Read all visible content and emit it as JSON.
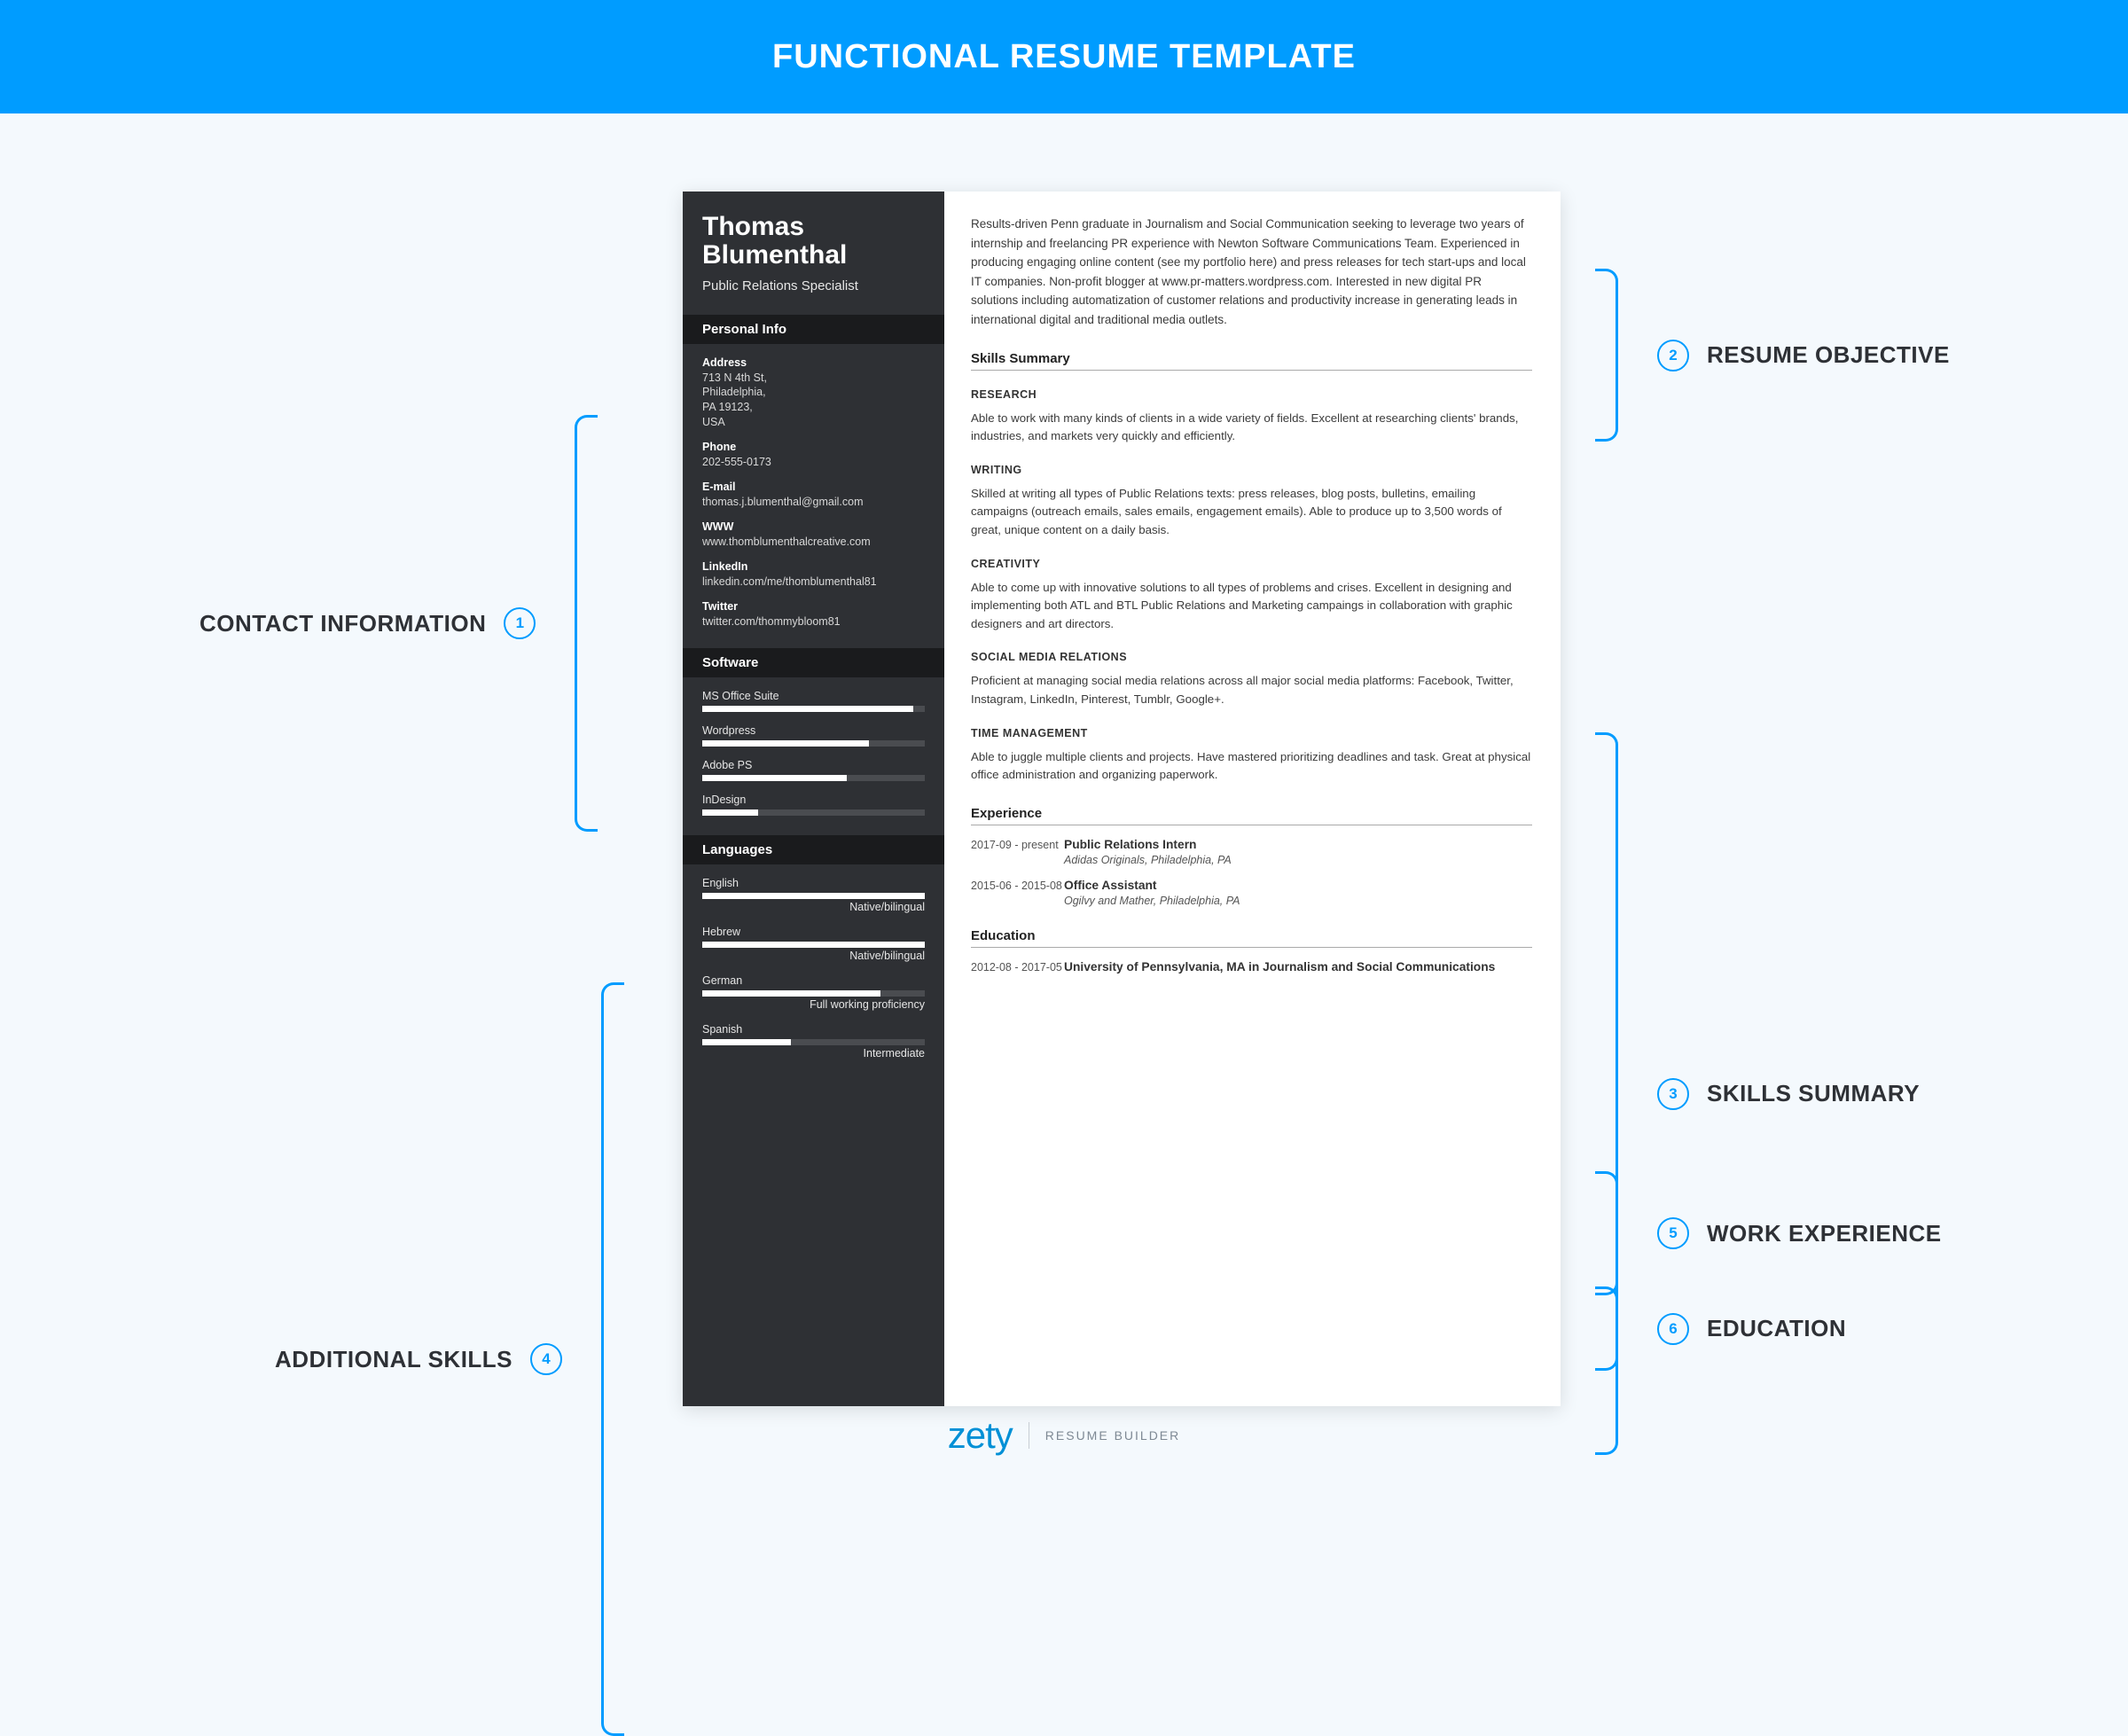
{
  "header": {
    "title": "FUNCTIONAL RESUME TEMPLATE"
  },
  "annotations": {
    "contact": {
      "num": "1",
      "label": "CONTACT INFORMATION"
    },
    "addskills": {
      "num": "4",
      "label": "ADDITIONAL SKILLS"
    },
    "objective": {
      "num": "2",
      "label": "RESUME OBJECTIVE"
    },
    "skills": {
      "num": "3",
      "label": "SKILLS SUMMARY"
    },
    "work": {
      "num": "5",
      "label": "WORK EXPERIENCE"
    },
    "education": {
      "num": "6",
      "label": "EDUCATION"
    }
  },
  "resume": {
    "nameFirst": "Thomas",
    "nameLast": "Blumenthal",
    "subtitle": "Public Relations Specialist",
    "sideHeading1": "Personal Info",
    "sideHeading2": "Software",
    "sideHeading3": "Languages",
    "info": {
      "addressLabel": "Address",
      "address": "713 N 4th St,\nPhiladelphia,\nPA 19123,\nUSA",
      "phoneLabel": "Phone",
      "phone": "202-555-0173",
      "emailLabel": "E-mail",
      "email": "thomas.j.blumenthal@gmail.com",
      "wwwLabel": "WWW",
      "www": "www.thomblumenthalcreative.com",
      "linkedinLabel": "LinkedIn",
      "linkedin": "linkedin.com/me/thomblumenthal81",
      "twitterLabel": "Twitter",
      "twitter": "twitter.com/thommybloom81"
    },
    "software": [
      {
        "name": "MS Office Suite",
        "pct": 95,
        "level": ""
      },
      {
        "name": "Wordpress",
        "pct": 75,
        "level": ""
      },
      {
        "name": "Adobe PS",
        "pct": 65,
        "level": ""
      },
      {
        "name": "InDesign",
        "pct": 25,
        "level": ""
      }
    ],
    "languages": [
      {
        "name": "English",
        "pct": 100,
        "level": "Native/bilingual"
      },
      {
        "name": "Hebrew",
        "pct": 100,
        "level": "Native/bilingual"
      },
      {
        "name": "German",
        "pct": 80,
        "level": "Full working proficiency"
      },
      {
        "name": "Spanish",
        "pct": 40,
        "level": "Intermediate"
      }
    ],
    "objective": "Results-driven Penn graduate in Journalism and Social Communication seeking to leverage two years of internship and freelancing PR experience with Newton Software Communications Team. Experienced in producing engaging online content (see my portfolio here) and press releases for tech start-ups and local IT companies. Non-profit blogger at www.pr-matters.wordpress.com. Interested in new digital PR solutions including automatization of customer relations and productivity increase in generating leads in international digital and traditional media outlets.",
    "h2skills": "Skills Summary",
    "skills": [
      {
        "name": "RESEARCH",
        "text": "Able to work with many kinds of clients in a wide variety of fields. Excellent at researching clients' brands, industries, and markets very quickly and efficiently."
      },
      {
        "name": "WRITING",
        "text": "Skilled at writing all types of Public Relations texts: press releases, blog posts, bulletins, emailing campaigns (outreach emails, sales emails, engagement emails). Able to produce up to 3,500 words of great, unique content on a daily basis."
      },
      {
        "name": "CREATIVITY",
        "text": "Able to come up with innovative solutions to all types of problems and crises. Excellent in designing and implementing both ATL and BTL Public Relations and Marketing campaings in collaboration with graphic designers and art directors."
      },
      {
        "name": "SOCIAL MEDIA RELATIONS",
        "text": "Proficient at managing social media relations across all major social media platforms: Facebook, Twitter, Instagram, LinkedIn, Pinterest, Tumblr, Google+."
      },
      {
        "name": "TIME MANAGEMENT",
        "text": "Able to juggle multiple clients and projects. Have mastered prioritizing deadlines and task. Great at physical office administration and organizing paperwork."
      }
    ],
    "h2exp": "Experience",
    "experience": [
      {
        "dates": "2017-09 - present",
        "title": "Public Relations Intern",
        "sub": "Adidas Originals, Philadelphia, PA"
      },
      {
        "dates": "2015-06 - 2015-08",
        "title": "Office Assistant",
        "sub": "Ogilvy and Mather, Philadelphia, PA"
      }
    ],
    "h2edu": "Education",
    "education": [
      {
        "dates": "2012-08 - 2017-05",
        "title": "University of Pennsylvania, MA in Journalism and Social Communications"
      }
    ]
  },
  "footer": {
    "brand": "zety",
    "tag": "RESUME BUILDER"
  }
}
